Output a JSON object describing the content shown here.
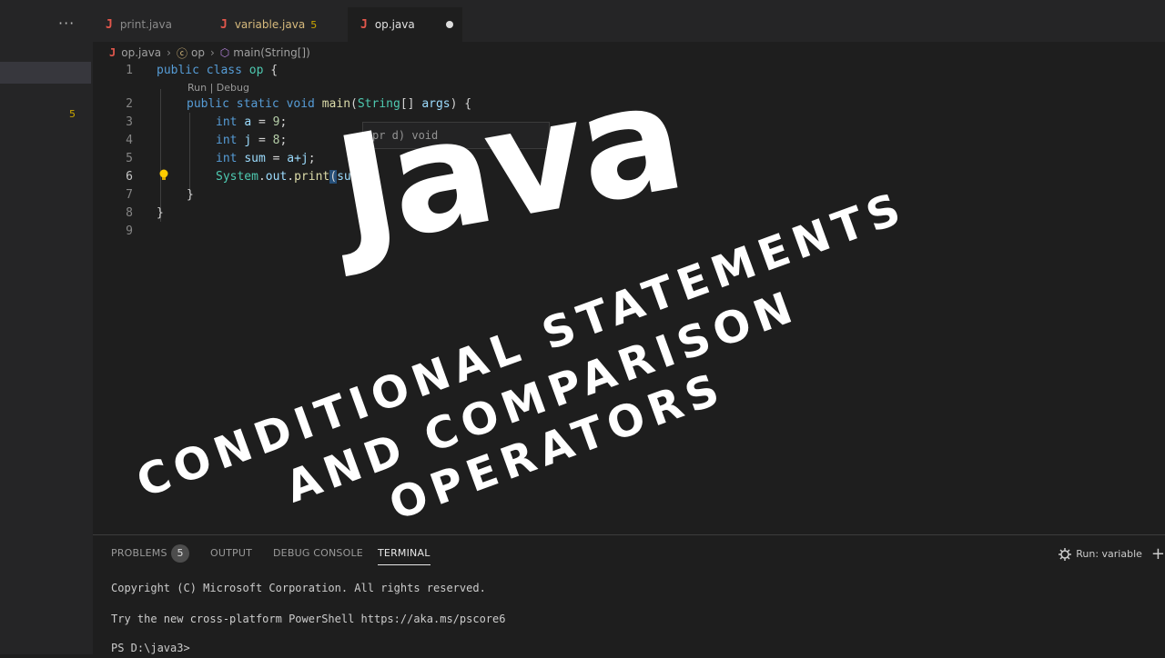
{
  "sidebar": {
    "more_icon": "ellipsis-icon",
    "badge": "5"
  },
  "tabs": [
    {
      "label": "print.java",
      "icon": "java-file-icon"
    },
    {
      "label": "variable.java",
      "count": "5",
      "icon": "java-file-icon"
    },
    {
      "label": "op.java",
      "icon": "java-file-icon",
      "dirty": true
    }
  ],
  "breadcrumb": {
    "file": "op.java",
    "class": "op",
    "method": "main(String[])"
  },
  "editor": {
    "codelens": "Run | Debug",
    "line_numbers": [
      "1",
      "2",
      "3",
      "4",
      "5",
      "6",
      "7",
      "8",
      "9"
    ],
    "hint_text": "pr              d)    void",
    "lines": {
      "l1": {
        "kw": "public class ",
        "name": "op",
        "rest": " {"
      },
      "l2": {
        "kw1": "public static void ",
        "fn": "main",
        "p1": "(",
        "ty": "String",
        "p2": "[] ",
        "var": "args",
        "p3": ") {"
      },
      "l3": {
        "kw": "int ",
        "var": "a",
        "eq": " = ",
        "num": "9",
        "end": ";"
      },
      "l4": {
        "kw": "int ",
        "var": "j",
        "eq": " = ",
        "num": "8",
        "end": ";"
      },
      "l5": {
        "kw": "int ",
        "var": "sum",
        "eq": " = ",
        "expr": "a+j",
        "end": ";"
      },
      "l6": {
        "obj": "System",
        "dot1": ".",
        "field": "out",
        "dot2": ".",
        "fn": "print",
        "p": "(",
        "arg": "sum"
      },
      "l7": "}",
      "l8": "}"
    }
  },
  "panel": {
    "tabs": [
      "PROBLEMS",
      "OUTPUT",
      "DEBUG CONSOLE",
      "TERMINAL"
    ],
    "problems_count": "5",
    "active_tab": "TERMINAL",
    "run_label": "Run: variable",
    "terminal_lines": [
      "Copyright (C) Microsoft Corporation. All rights reserved.",
      "Try the new cross-platform PowerShell https://aka.ms/pscore6",
      "PS D:\\java3>"
    ]
  },
  "overlay": {
    "title": "Java",
    "subtitle_lines": [
      "CONDITIONAL STATEMENTS",
      "AND COMPARISON",
      "OPERATORS"
    ],
    "text_color": "#ffffff"
  }
}
